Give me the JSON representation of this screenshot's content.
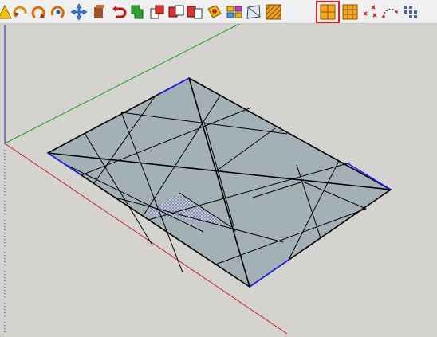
{
  "toolbar": {
    "tools": [
      {
        "name": "protractor-tool-icon"
      },
      {
        "name": "rotate-tool-icon"
      },
      {
        "name": "follow-me-tool-icon"
      },
      {
        "name": "orbit-tool-icon"
      },
      {
        "name": "move-tool-icon"
      },
      {
        "name": "push-pull-tool-icon"
      },
      {
        "name": "undo-tool-icon"
      },
      {
        "name": "green-shape-tool-icon"
      },
      {
        "name": "intersect-tool-icon"
      },
      {
        "name": "subtract-tool-icon"
      },
      {
        "name": "trim-tool-icon"
      },
      {
        "name": "paint-face-tool-icon"
      },
      {
        "name": "components-tool-icon"
      },
      {
        "name": "scale-tool-icon"
      },
      {
        "name": "hatch-grid-tool-icon"
      },
      {
        "name": "quad-grid-tool-icon",
        "selected": true
      },
      {
        "name": "dense-grid-tool-icon"
      },
      {
        "name": "scatter-points-tool-icon"
      },
      {
        "name": "arc-tool-icon"
      },
      {
        "name": "grid-points-tool-icon"
      }
    ]
  },
  "scene": {
    "axis_colors": {
      "x": "#cc2020",
      "y": "#20a020",
      "z": "#2020cc"
    },
    "face_color": "#a3b0b6",
    "edge_color": "#000000",
    "highlight_edge_color": "#1a1aff",
    "selected_face": "dotted-triangle"
  }
}
